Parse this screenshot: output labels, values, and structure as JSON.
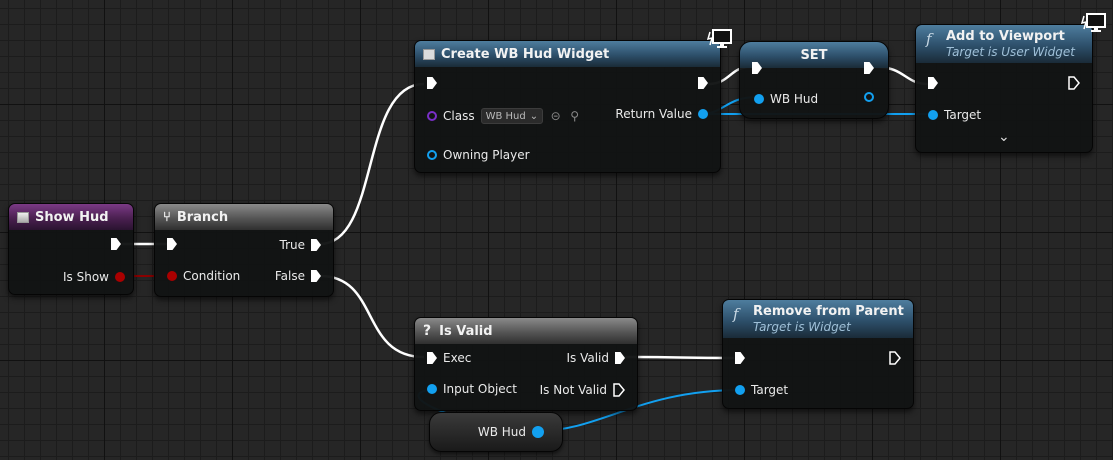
{
  "colors": {
    "event": "#7b3a86",
    "flow": "#8a8a8a",
    "function": "#4e7d9e",
    "object_pin": "#12a0f0",
    "bool_pin": "#a00000",
    "class_pin": "#7a2fc8"
  },
  "show_hud": {
    "title": "Show Hud",
    "is_show": "Is Show"
  },
  "branch": {
    "title": "Branch",
    "condition": "Condition",
    "true": "True",
    "false": "False"
  },
  "create_widget": {
    "title": "Create WB Hud Widget",
    "class": "Class",
    "class_value": "WB Hud",
    "owning_player": "Owning Player",
    "return_value": "Return Value",
    "icon": "monitor-icon"
  },
  "set_node": {
    "title": "SET",
    "var": "WB Hud"
  },
  "add_viewport": {
    "title": "Add to Viewport",
    "subtitle": "Target is User Widget",
    "target": "Target",
    "icon": "monitor-icon"
  },
  "is_valid": {
    "title": "Is Valid",
    "exec": "Exec",
    "input_object": "Input Object",
    "is_valid": "Is Valid",
    "is_not_valid": "Is Not Valid"
  },
  "remove_parent": {
    "title": "Remove from Parent",
    "subtitle": "Target is Widget",
    "target": "Target"
  },
  "wb_hud_getter": {
    "label": "WB Hud"
  }
}
